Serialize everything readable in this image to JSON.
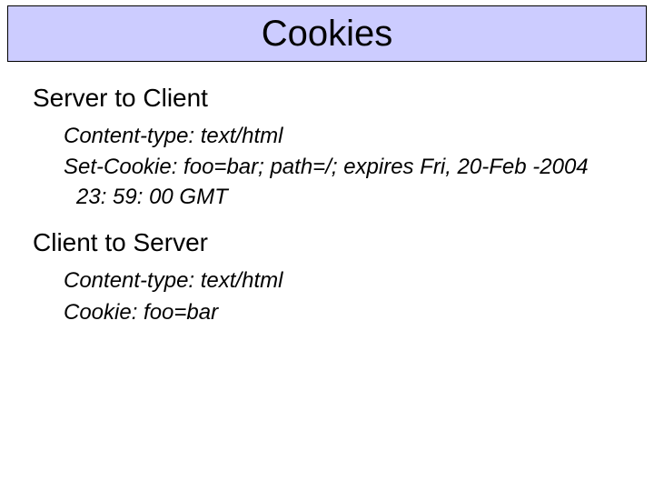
{
  "title": "Cookies",
  "sections": [
    {
      "heading": "Server to Client",
      "lines": [
        "Content-type: text/html",
        "Set-Cookie: foo=bar; path=/; expires Fri, 20-Feb -2004 23: 59: 00 GMT"
      ]
    },
    {
      "heading": "Client to Server",
      "lines": [
        "Content-type: text/html",
        "Cookie: foo=bar"
      ]
    }
  ]
}
